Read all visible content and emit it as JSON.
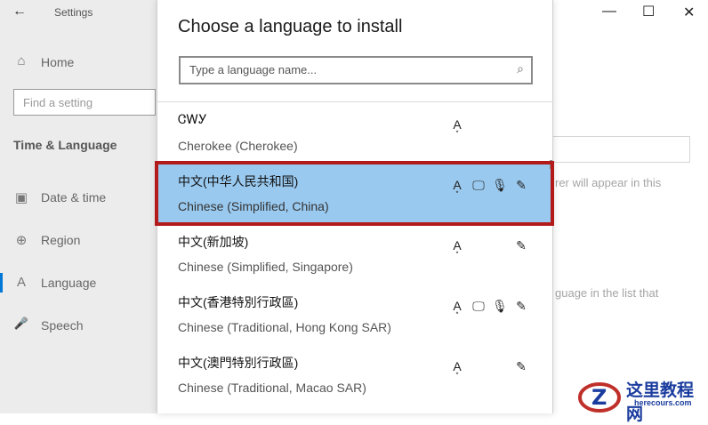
{
  "window": {
    "title": "Settings",
    "controls": {
      "minimize": "—",
      "maximize": "☐",
      "close": "✕"
    }
  },
  "sidebar": {
    "back_icon": "←",
    "home_label": "Home",
    "home_icon": "⌂",
    "search_placeholder": "Find a setting",
    "section_title": "Time & Language",
    "items": [
      {
        "label": "Date & time",
        "icon": "▣"
      },
      {
        "label": "Region",
        "icon": "⊕"
      },
      {
        "label": "Language",
        "icon": "A"
      },
      {
        "label": "Speech",
        "icon": "🎤"
      }
    ]
  },
  "background": {
    "text1": "rer will appear in this",
    "text2": "guage in the list that"
  },
  "dialog": {
    "title": "Choose a language to install",
    "search_placeholder": "Type a language name...",
    "search_icon": "⌕",
    "languages": [
      {
        "native": "ᏣᎳᎩ",
        "english": "Cherokee (Cherokee)",
        "features": [
          "display-language"
        ]
      },
      {
        "native": "中文(中华人民共和国)",
        "english": "Chinese (Simplified, China)",
        "features": [
          "display-language",
          "text-to-speech",
          "speech-recognition",
          "handwriting"
        ],
        "selected": true
      },
      {
        "native": "中文(新加坡)",
        "english": "Chinese (Simplified, Singapore)",
        "features": [
          "display-language",
          "handwriting"
        ]
      },
      {
        "native": "中文(香港特別行政區)",
        "english": "Chinese (Traditional, Hong Kong SAR)",
        "features": [
          "display-language",
          "text-to-speech",
          "speech-recognition",
          "handwriting"
        ]
      },
      {
        "native": "中文(澳門特別行政區)",
        "english": "Chinese (Traditional, Macao SAR)",
        "features": [
          "display-language",
          "handwriting"
        ]
      }
    ],
    "feature_glyphs": {
      "display-language": "A͙",
      "text-to-speech": "🖵",
      "speech-recognition": "🎙",
      "handwriting": "✎"
    }
  },
  "watermark": {
    "logo_letter": "Z",
    "text": "这里教程网",
    "sub": "herecours.com"
  },
  "colors": {
    "selected_bg": "#99c9ef",
    "highlight_frame": "#b31b1b",
    "accent": "#0078d7"
  }
}
